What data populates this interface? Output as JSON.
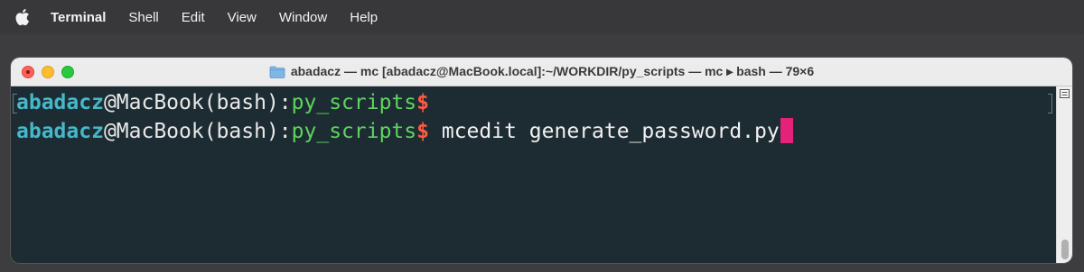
{
  "menubar": {
    "apple_icon": "apple-logo-icon",
    "items": [
      {
        "label": "Terminal"
      },
      {
        "label": "Shell"
      },
      {
        "label": "Edit"
      },
      {
        "label": "View"
      },
      {
        "label": "Window"
      },
      {
        "label": "Help"
      }
    ]
  },
  "window": {
    "title": "abadacz — mc [abadacz@MacBook.local]:~/WORKDIR/py_scripts — mc ▸ bash — 79×6",
    "folder_icon": "folder-icon",
    "colors": {
      "background": "#1d2c33",
      "user": "#45b8c9",
      "directory": "#5fd35f",
      "prompt_symbol": "#ff5a42",
      "cursor": "#e5227a"
    }
  },
  "terminal": {
    "lines": [
      {
        "user": "abadacz",
        "host": "@MacBook(bash):",
        "dir": "py_scripts",
        "symbol": "$",
        "command": ""
      },
      {
        "user": "abadacz",
        "host": "@MacBook(bash):",
        "dir": "py_scripts",
        "symbol": "$",
        "command": " mcedit generate_password.py"
      }
    ]
  }
}
